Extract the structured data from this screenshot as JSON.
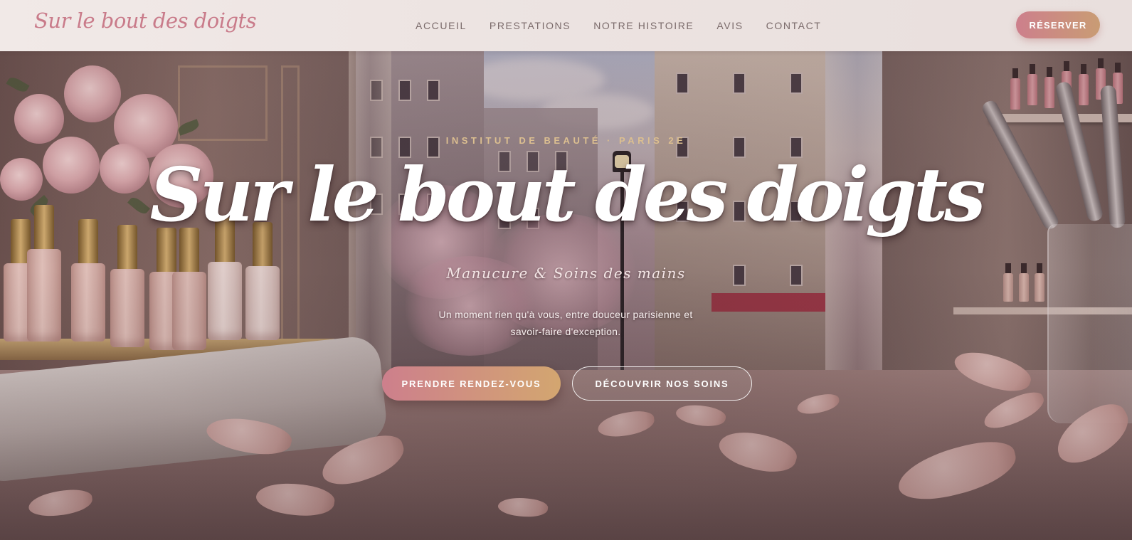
{
  "nav": {
    "brand": "Sur le bout des doigts",
    "links": [
      {
        "label": "ACCUEIL"
      },
      {
        "label": "PRESTATIONS"
      },
      {
        "label": "NOTRE HISTOIRE"
      },
      {
        "label": "AVIS"
      },
      {
        "label": "CONTACT"
      }
    ],
    "cta_label": "RÉSERVER"
  },
  "hero": {
    "eyebrow": "INSTITUT DE BEAUTÉ · PARIS 2E",
    "title": "Sur le bout des doigts",
    "subtitle": "Manucure & Soins des mains",
    "description": "Un moment rien qu'à vous, entre douceur parisienne et savoir-faire d'exception.",
    "primary_button": "PRENDRE RENDEZ-VOUS",
    "secondary_button": "DÉCOUVRIR NOS SOINS"
  },
  "colors": {
    "brand_pink": "#c97b8a",
    "gradient_start": "#cd7f8c",
    "gradient_end": "#d3a670",
    "eyebrow_gold": "#dcbf90",
    "nav_background": "#efe7e5"
  }
}
